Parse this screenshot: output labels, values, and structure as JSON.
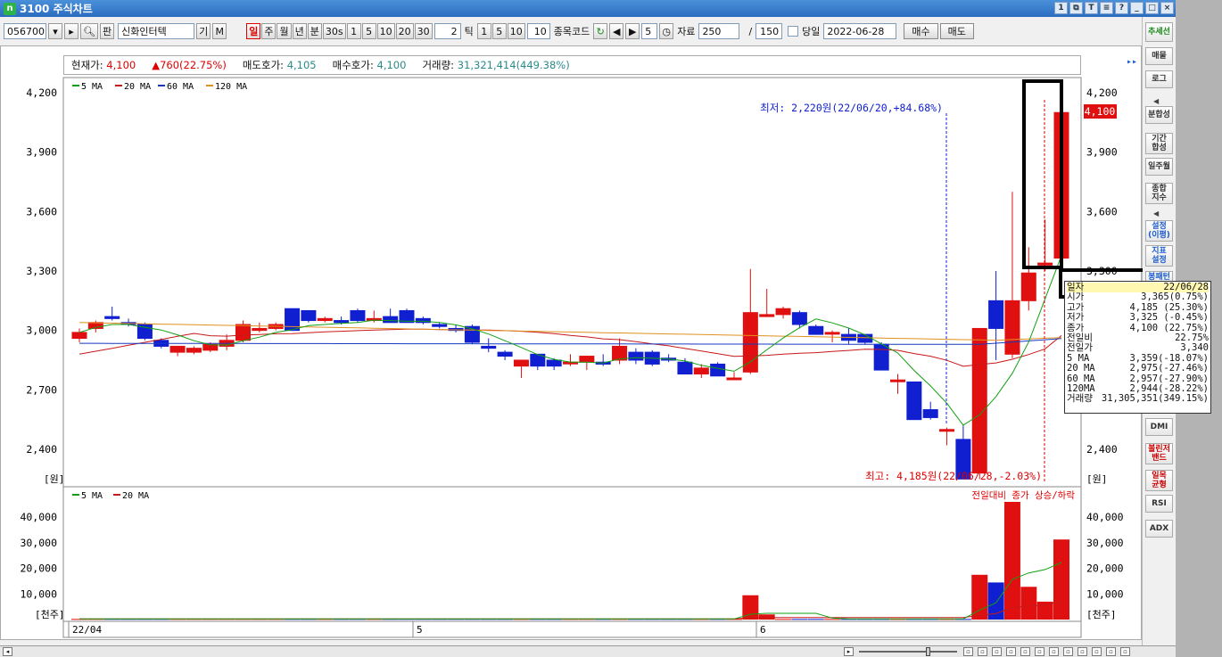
{
  "window": {
    "title": "3100 주식차트",
    "logo": "n"
  },
  "toolbar": {
    "code": "056700",
    "name": "신화인터텍",
    "btn_gi": "기",
    "btn_m": "M",
    "periods": [
      "일",
      "주",
      "월",
      "년",
      "분",
      "30s",
      "1",
      "5",
      "10",
      "20",
      "30"
    ],
    "tick_value": "2",
    "tick_label": "틱",
    "tick_opts": [
      "1",
      "5",
      "10"
    ],
    "tick_val2": "10",
    "item_code_label": "종목코드",
    "speed": "5",
    "data_label": "자료",
    "data_count": "250",
    "slash": "/",
    "view_count": "150",
    "today_label": "당일",
    "date": "2022-06-28",
    "buy": "매수",
    "sell": "매도",
    "search_icon": "search-icon",
    "fan": "판"
  },
  "info": {
    "cur_label": "현재가:",
    "cur": "4,100",
    "chg": "▲760(22.75%)",
    "ask_label": "매도호가:",
    "ask": "4,105",
    "bid_label": "매수호가:",
    "bid": "4,100",
    "vol_label": "거래량:",
    "vol": "31,321,414(449.38%)"
  },
  "sidebar": [
    "추세선",
    "매물",
    "로그",
    "분합성",
    "기간\n합성",
    "일주월",
    "종합\n지수",
    "설정\n(이평)",
    "지표\n설정",
    "봉패턴",
    "DMI",
    "볼린저\n밴드",
    "일목\n균형",
    "RSI",
    "ADX"
  ],
  "price_panel": {
    "ma_legend": [
      {
        "name": "5 MA",
        "color": "#12a012"
      },
      {
        "name": "20 MA",
        "color": "#c81818"
      },
      {
        "name": "60 MA",
        "color": "#1838c0"
      },
      {
        "name": "120 MA",
        "color": "#e09020"
      }
    ],
    "unit": "[원]",
    "y_ticks": [
      "4,200",
      "3,900",
      "3,600",
      "3,300",
      "3,000",
      "2,700",
      "2,400"
    ],
    "cur_price_tag": "4,100",
    "annot_low": "최저: 2,220원(22/06/20,+84.68%)",
    "annot_high": "최고: 4,185원(22/06/28,-2.03%)"
  },
  "volume_panel": {
    "ma_legend": [
      {
        "name": "5 MA",
        "color": "#12a012"
      },
      {
        "name": "20 MA",
        "color": "#c81818"
      }
    ],
    "unit": "[천주]",
    "y_ticks": [
      "40,000",
      "30,000",
      "20,000",
      "10,000"
    ],
    "note": "전일대비 종가 상승/하락"
  },
  "x_axis": {
    "labels": [
      "22/04",
      "5",
      "6"
    ]
  },
  "tooltip": {
    "rows": [
      [
        "일자",
        "22/06/28"
      ],
      [
        "시가",
        "3,365(0.75%)"
      ],
      [
        "고가",
        "4,185 (25.30%)"
      ],
      [
        "저가",
        "3,325 (-0.45%)"
      ],
      [
        "종가",
        "4,100 (22.75%)"
      ],
      [
        "전일비",
        "22.75%"
      ],
      [
        "전일가",
        "3,340"
      ],
      [
        "5  MA",
        "3,359(-18.07%)"
      ],
      [
        "20 MA",
        "2,975(-27.46%)"
      ],
      [
        "60 MA",
        "2,957(-27.90%)"
      ],
      [
        "120MA",
        "2,944(-28.22%)"
      ],
      [
        "거래량",
        "31,305,351(349.15%)"
      ]
    ]
  },
  "chart_data": {
    "type": "candlestick",
    "ylim": [
      2250,
      4250
    ],
    "candles": [
      [
        2960,
        3010,
        2940,
        2990
      ],
      [
        3010,
        3050,
        2990,
        3040
      ],
      [
        3070,
        3120,
        3050,
        3060
      ],
      [
        3040,
        3060,
        3020,
        3030
      ],
      [
        3030,
        3040,
        2950,
        2960
      ],
      [
        2950,
        2960,
        2910,
        2920
      ],
      [
        2890,
        2920,
        2870,
        2920
      ],
      [
        2890,
        2920,
        2880,
        2910
      ],
      [
        2900,
        2940,
        2890,
        2930
      ],
      [
        2920,
        2980,
        2900,
        2950
      ],
      [
        2950,
        3050,
        2940,
        3030
      ],
      [
        3000,
        3040,
        2990,
        3010
      ],
      [
        3010,
        3040,
        3000,
        3030
      ],
      [
        3110,
        3110,
        3000,
        3000
      ],
      [
        3100,
        3100,
        3040,
        3050
      ],
      [
        3050,
        3070,
        3040,
        3060
      ],
      [
        3050,
        3070,
        3030,
        3040
      ],
      [
        3100,
        3110,
        3040,
        3050
      ],
      [
        3050,
        3100,
        3040,
        3060
      ],
      [
        3070,
        3110,
        3040,
        3040
      ],
      [
        3100,
        3110,
        3040,
        3040
      ],
      [
        3060,
        3070,
        3030,
        3040
      ],
      [
        3030,
        3040,
        3010,
        3020
      ],
      [
        3010,
        3030,
        2990,
        3000
      ],
      [
        3020,
        3030,
        2930,
        2940
      ],
      [
        2920,
        2960,
        2890,
        2910
      ],
      [
        2890,
        2900,
        2850,
        2870
      ],
      [
        2820,
        2840,
        2760,
        2850
      ],
      [
        2880,
        2880,
        2800,
        2820
      ],
      [
        2850,
        2860,
        2800,
        2820
      ],
      [
        2840,
        2880,
        2820,
        2840
      ],
      [
        2840,
        2870,
        2800,
        2870
      ],
      [
        2840,
        2880,
        2820,
        2830
      ],
      [
        2850,
        2960,
        2830,
        2920
      ],
      [
        2890,
        2910,
        2830,
        2850
      ],
      [
        2890,
        2900,
        2820,
        2830
      ],
      [
        2860,
        2880,
        2840,
        2850
      ],
      [
        2840,
        2860,
        2780,
        2780
      ],
      [
        2780,
        2830,
        2760,
        2810
      ],
      [
        2830,
        2840,
        2770,
        2770
      ],
      [
        2760,
        2790,
        2750,
        2760
      ],
      [
        2790,
        3310,
        2780,
        3090
      ],
      [
        3070,
        3210,
        3070,
        3080
      ],
      [
        3080,
        3120,
        3060,
        3110
      ],
      [
        3090,
        3100,
        3010,
        3030
      ],
      [
        3020,
        3030,
        2980,
        2980
      ],
      [
        2990,
        3000,
        2940,
        2990
      ],
      [
        2980,
        3010,
        2930,
        2950
      ],
      [
        2980,
        2980,
        2930,
        2940
      ],
      [
        2930,
        2940,
        2800,
        2800
      ],
      [
        2750,
        2780,
        2680,
        2750
      ],
      [
        2740,
        2740,
        2550,
        2550
      ],
      [
        2600,
        2640,
        2550,
        2560
      ],
      [
        2500,
        2510,
        2420,
        2500
      ],
      [
        2450,
        2520,
        2270,
        2250
      ],
      [
        2280,
        3010,
        2250,
        3010
      ],
      [
        3150,
        3300,
        2850,
        3010
      ],
      [
        2880,
        3700,
        2860,
        3150
      ],
      [
        3150,
        3420,
        3100,
        3290
      ],
      [
        3330,
        3560,
        3300,
        3340
      ],
      [
        3365,
        4185,
        3325,
        4100
      ]
    ],
    "volumes": [
      250,
      250,
      250,
      250,
      250,
      250,
      250,
      250,
      250,
      250,
      250,
      250,
      250,
      250,
      250,
      250,
      250,
      250,
      250,
      250,
      250,
      250,
      250,
      250,
      250,
      250,
      250,
      250,
      250,
      250,
      250,
      250,
      250,
      250,
      250,
      250,
      250,
      250,
      250,
      250,
      250,
      9500,
      2000,
      250,
      250,
      250,
      250,
      250,
      250,
      250,
      250,
      250,
      250,
      250,
      250,
      17500,
      14500,
      46000,
      12800,
      7000,
      31300
    ]
  }
}
